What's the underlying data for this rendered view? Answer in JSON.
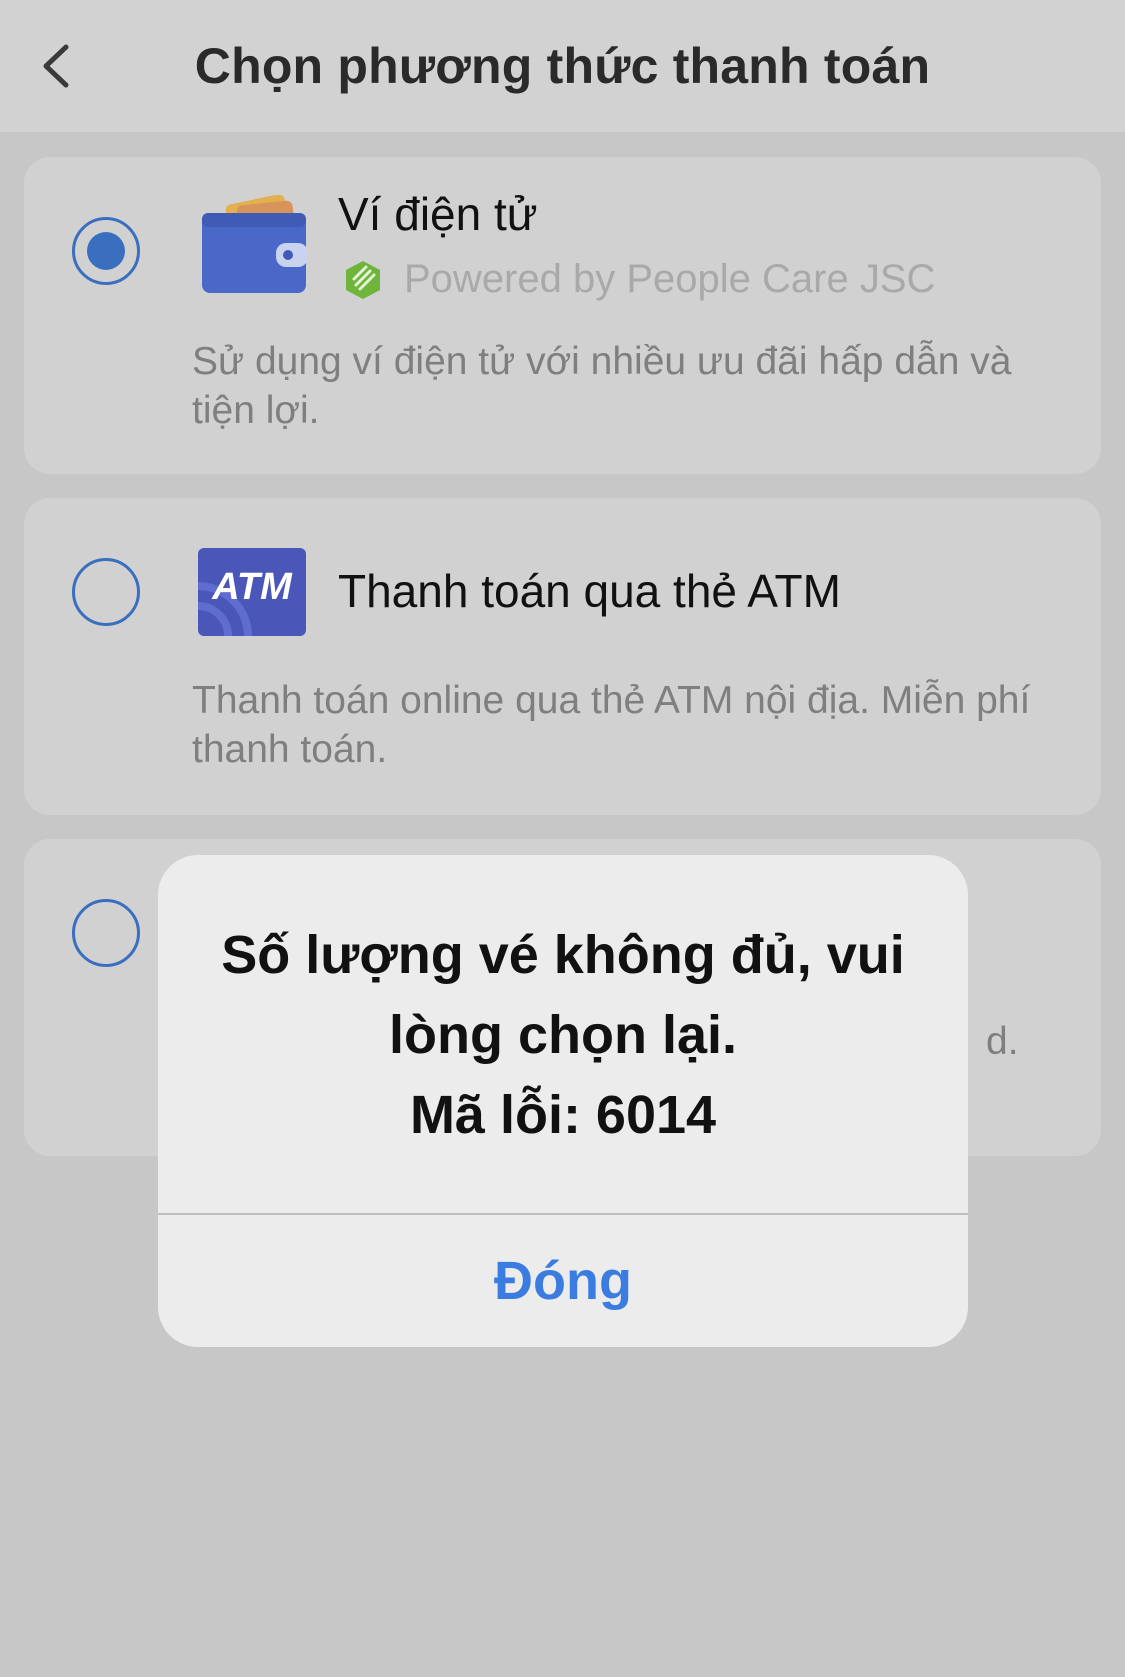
{
  "header": {
    "title": "Chọn phương thức thanh toán",
    "back_icon": "chevron-left-icon"
  },
  "payment_methods": [
    {
      "title": "Ví điện tử",
      "subtitle": "Powered by People Care JSC",
      "description": "Sử dụng ví điện tử với nhiều ưu đãi hấp dẫn và tiện lợi.",
      "selected": true,
      "icon": "wallet-icon"
    },
    {
      "title": "Thanh toán qua thẻ ATM",
      "icon_label": "ATM",
      "description": "Thanh toán online qua thẻ ATM nội địa. Miễn phí thanh toán.",
      "selected": false,
      "icon": "atm-card-icon"
    },
    {
      "partial_description": "d.",
      "selected": false
    }
  ],
  "dialog": {
    "message_line1": "Số lượng vé không đủ, vui lòng chọn lại.",
    "message_line2": "Mã lỗi: 6014",
    "button_label": "Đóng"
  },
  "colors": {
    "accent": "#3a6fc0",
    "dialog_button": "#3a7ce0",
    "overlay_background": "#c7c7c7",
    "card_background": "#d1d1d1"
  }
}
